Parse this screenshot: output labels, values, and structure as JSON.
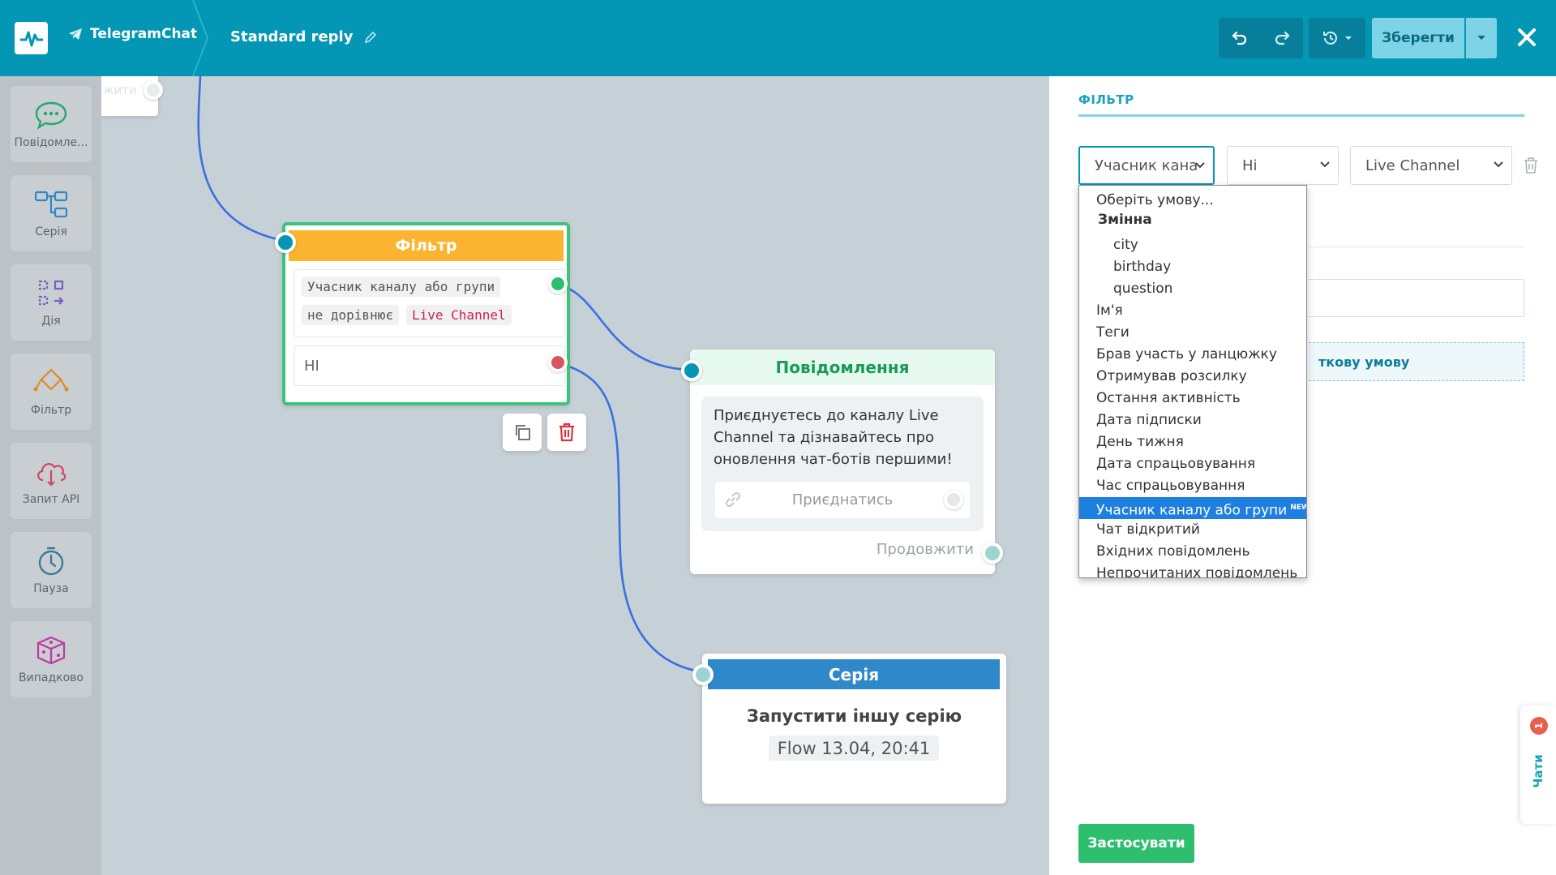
{
  "header": {
    "bot_name": "TelegramChat",
    "flow_name": "Standard reply",
    "save_label": "Зберегти"
  },
  "sidebar": {
    "items": [
      {
        "label": "Повідомле..."
      },
      {
        "label": "Серія"
      },
      {
        "label": "Дія"
      },
      {
        "label": "Фільтр"
      },
      {
        "label": "Запит API"
      },
      {
        "label": "Пауза"
      },
      {
        "label": "Випадково"
      }
    ]
  },
  "canvas": {
    "partial_node_text": "жити",
    "filter_node": {
      "title": "Фільтр",
      "condition_field": "Учасник каналу або групи",
      "condition_op": "не дорівнює",
      "condition_value": "Live Channel",
      "else_label": "НІ"
    },
    "message_node": {
      "title": "Повідомлення",
      "text": "Приєднуєтесь до каналу Live Channel та дізнавайтесь про оновлення чат-ботів першими!",
      "button_label": "Приєднатись",
      "continue_label": "Продовжити"
    },
    "series_node": {
      "title": "Серія",
      "action": "Запустити іншу серію",
      "flow_name": "Flow 13.04, 20:41"
    }
  },
  "panel": {
    "section_title": "ФІЛЬТР",
    "field_select": "Учасник кана",
    "op_select": "Ні",
    "value_select": "Live Channel",
    "add_condition_partial": "ткову умову",
    "apply_label": "Застосувати",
    "chats_label": "Чати",
    "chats_count": "1"
  },
  "dropdown": {
    "placeholder": "Оберіть умову...",
    "group_label": "Змінна",
    "variables": [
      "city",
      "birthday",
      "question"
    ],
    "options": [
      "Ім'я",
      "Теги",
      "Брав участь у ланцюжку",
      "Отримував розсилку",
      "Остання активність",
      "Дата підписки",
      "День тижня",
      "Дата спрацьовування",
      "Час спрацьовування",
      "Учасник каналу або групи",
      "Чат відкритий",
      "Вхідних повідомлень",
      "Непрочитаних повідомлень"
    ],
    "new_badge": "NEW"
  },
  "colors": {
    "header": "#0496b5",
    "filter_title": "#fbb430",
    "filter_border": "#40c27a",
    "message_title_bg": "#e6faf0",
    "message_title_text": "#1a9a5a",
    "series_title": "#2f88c9",
    "apply_button": "#2dbf6e",
    "connection": "#3b6fe0",
    "selected_option": "#1d7fe0"
  }
}
